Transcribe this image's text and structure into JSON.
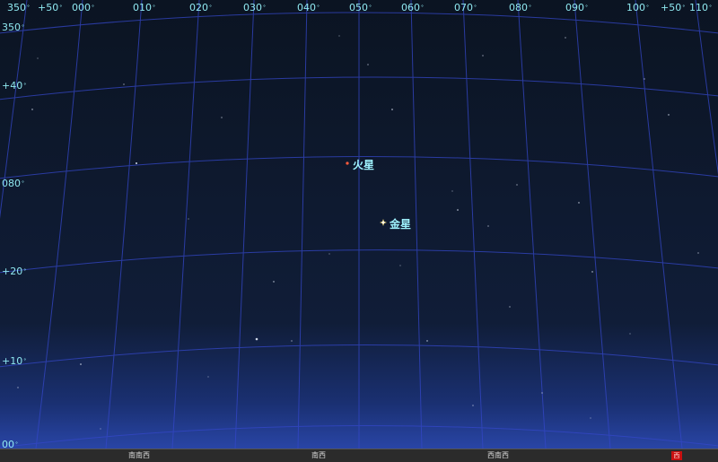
{
  "colors": {
    "sky_top": "#0b1422",
    "sky_bottom": "#1e3a8a",
    "grid": "#3b4fd6",
    "label": "#8fe8f0",
    "venus": "#ffe680",
    "mars": "#ff5a3c"
  },
  "top_labels": [
    "350",
    "+50",
    "000",
    "010",
    "020",
    "030",
    "040",
    "050",
    "060",
    "070",
    "080",
    "090",
    "100",
    "+50",
    "110"
  ],
  "left_labels": [
    "350",
    "+40",
    "080",
    "+20",
    "+10",
    "00"
  ],
  "planets": [
    {
      "name": "火星",
      "icon": "mars-dot-icon"
    },
    {
      "name": "金星",
      "icon": "venus-star-icon"
    }
  ],
  "horizon": {
    "directions": [
      "南南西",
      "南西",
      "西南西"
    ],
    "marker": "西",
    "marker_icon": "direction-marker-icon"
  }
}
